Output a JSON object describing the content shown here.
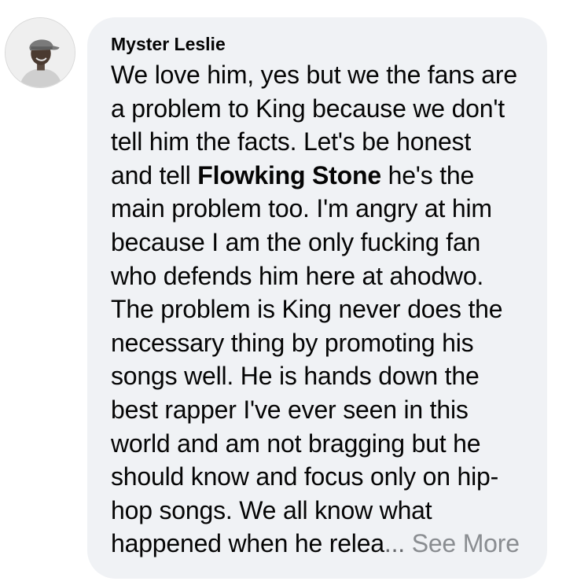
{
  "comment": {
    "author": "Myster Leslie",
    "avatar_icon": "user-avatar-icon",
    "mention": "Flowking Stone",
    "lines": [
      "We love him, yes but we the fans are",
      "a problem to King because we don't",
      "tell him the facts. Let's be honest",
      {
        "before": "and tell ",
        "after": " he's the"
      },
      "main problem too. I'm angry at him",
      "because I am the only fucking fan",
      "who defends him here at ahodwo.",
      "The problem is King never does the",
      "necessary thing by promoting his",
      "songs well. He is hands down the",
      "best rapper I've ever seen in this",
      "world and am not bragging but he",
      "should know and focus only on hip-",
      "hop songs. We all know what",
      "happened when he relea"
    ],
    "ellipsis": "...",
    "see_more_label": "See More"
  },
  "colors": {
    "bubble_background": "#f0f2f5",
    "text": "#050505",
    "see_more": "#8a8d91"
  }
}
